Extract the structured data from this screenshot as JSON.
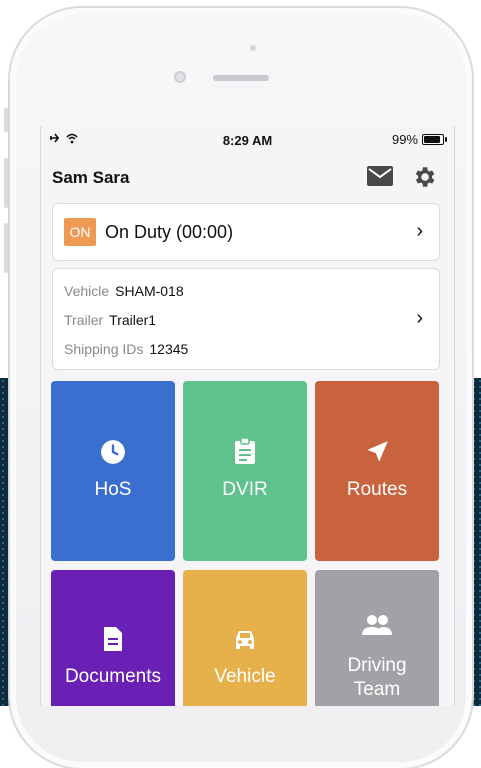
{
  "status_bar": {
    "time": "8:29 AM",
    "battery": "99%"
  },
  "header": {
    "name": "Sam Sara"
  },
  "duty": {
    "badge": "ON",
    "label": "On Duty (00:00)",
    "badge_color": "#ee9a55"
  },
  "info": {
    "vehicle_label": "Vehicle",
    "vehicle_value": "SHAM-018",
    "trailer_label": "Trailer",
    "trailer_value": "Trailer1",
    "shipping_label": "Shipping IDs",
    "shipping_value": "12345"
  },
  "tiles": [
    {
      "label": "HoS",
      "icon": "clock-icon",
      "color": "#3a6fd0"
    },
    {
      "label": "DVIR",
      "icon": "clipboard-icon",
      "color": "#5ec28c"
    },
    {
      "label": "Routes",
      "icon": "navigation-arrow-icon",
      "color": "#c8633e"
    },
    {
      "label": "Documents",
      "icon": "document-icon",
      "color": "#6a1fb5"
    },
    {
      "label": "Vehicle",
      "icon": "car-icon",
      "color": "#e6b04a"
    },
    {
      "label_line1": "Driving",
      "label_line2": "Team",
      "icon": "people-icon",
      "color": "#a1a2a6"
    }
  ]
}
